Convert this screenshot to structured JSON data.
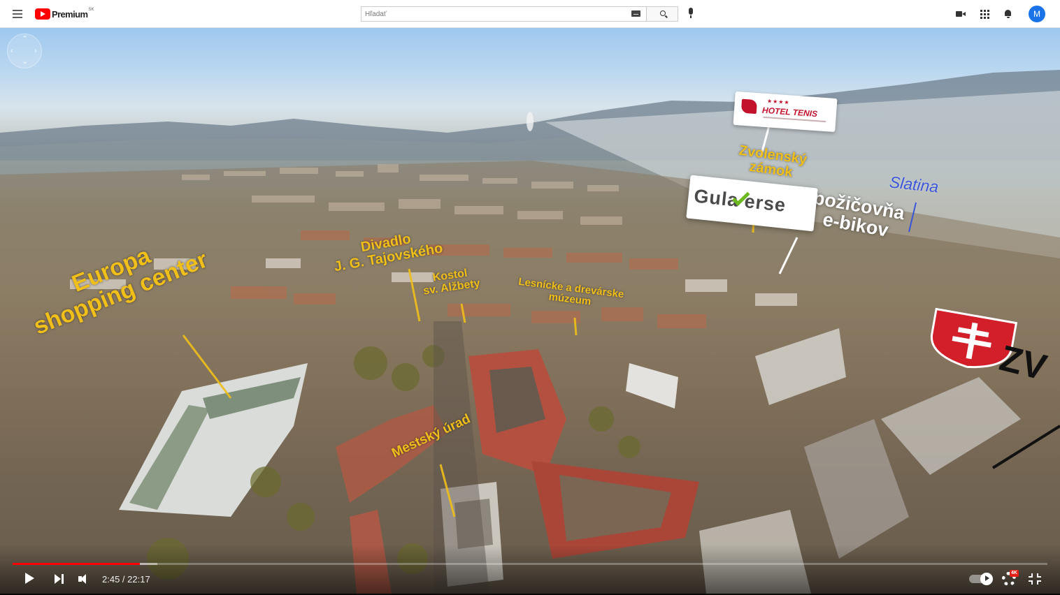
{
  "header": {
    "logo_text": "Premium",
    "logo_region": "SK",
    "search_placeholder": "Hľadať",
    "avatar_letter": "M"
  },
  "video": {
    "labels": {
      "europa": "Europa\nshopping center",
      "divadlo": "Divadlo\nJ. G. Tajovského",
      "kostol": "Kostol\nsv. Alžbety",
      "lesnicke": "Lesnícke a drevárske\nmúzeum",
      "mestsky": "Mestský úrad",
      "zvolensky": "Zvolenský\nzámok",
      "slatina": "Slatina",
      "pozicovna": "požičovňa\ne-bikov"
    },
    "signs": {
      "hotel_stars": "★★★★",
      "hotel_name": "HOTEL TENIS",
      "gulaverse": "Gula erse",
      "city_partial": "ZV"
    },
    "colors": {
      "label_yellow": "#f0bf1a",
      "slatina_blue": "#3b55d8",
      "progress_red": "#ff0000"
    }
  },
  "controls": {
    "current_time": "2:45",
    "duration": "22:17",
    "time_display": "2:45 / 22:17",
    "progress_fraction": 0.123,
    "loaded_fraction": 0.14,
    "quality_badge": "4K"
  }
}
